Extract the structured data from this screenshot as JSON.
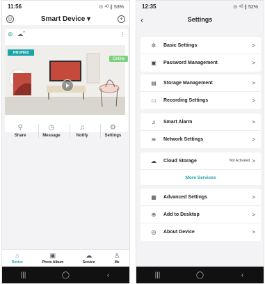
{
  "left": {
    "status": {
      "time": "11:56",
      "indicators": "⊙ ⁴ᴳ ∥ 53%"
    },
    "header": {
      "title": "Smart Device ▾",
      "left_icon": "face-icon",
      "right_icon": "plus-icon"
    },
    "device": {
      "name": "PM:IP843",
      "status": "Online",
      "more": "⋮"
    },
    "actions": [
      {
        "label": "Share",
        "icon": "share-icon",
        "glyph": "⚲"
      },
      {
        "label": "Message",
        "icon": "clock-icon",
        "glyph": "◷"
      },
      {
        "label": "Notify",
        "icon": "bell-off-icon",
        "glyph": "♫"
      },
      {
        "label": "Settings",
        "icon": "gear-icon",
        "glyph": "⚙"
      }
    ],
    "tabs": [
      {
        "label": "Device",
        "icon": "home-icon",
        "glyph": "⌂"
      },
      {
        "label": "Photo Album",
        "icon": "photo-icon",
        "glyph": "▣"
      },
      {
        "label": "Service",
        "icon": "cloud-icon",
        "glyph": "☁"
      },
      {
        "label": "Me",
        "icon": "person-icon",
        "glyph": "♙"
      }
    ],
    "navbar": [
      "|||",
      "◯",
      "‹"
    ]
  },
  "right": {
    "status": {
      "time": "12:35",
      "indicators": "⊙ ⁴ᴳ ∥ 52%"
    },
    "header": {
      "title": "Settings",
      "back": "‹"
    },
    "group1": [
      {
        "label": "Basic Settings",
        "icon": "gear-icon",
        "glyph": "✲"
      },
      {
        "label": "Password Management",
        "icon": "password-icon",
        "glyph": "▣"
      }
    ],
    "group2": [
      {
        "label": "Storage Management",
        "icon": "storage-icon",
        "glyph": "▤"
      },
      {
        "label": "Recording Settings",
        "icon": "record-icon",
        "glyph": "▭"
      }
    ],
    "group3": [
      {
        "label": "Smart Alarm",
        "icon": "alarm-icon",
        "glyph": "♫"
      },
      {
        "label": "Network Settings",
        "icon": "wifi-icon",
        "glyph": "≋"
      }
    ],
    "cloud": {
      "label": "Cloud Storage",
      "value": "Not Activated",
      "icon": "cloud-icon",
      "glyph": "☁",
      "more": "More Services"
    },
    "group4": [
      {
        "label": "Advanced Settings",
        "icon": "advanced-icon",
        "glyph": "▦"
      },
      {
        "label": "Add to Desktop",
        "icon": "desktop-icon",
        "glyph": "⊕"
      },
      {
        "label": "About Device",
        "icon": "info-icon",
        "glyph": "◎"
      }
    ],
    "chevron": ">",
    "navbar": [
      "|||",
      "◯",
      "‹"
    ]
  },
  "colors": {
    "accent": "#23a0a6",
    "online": "#7ed080",
    "device_tag": "#18a4a8"
  }
}
